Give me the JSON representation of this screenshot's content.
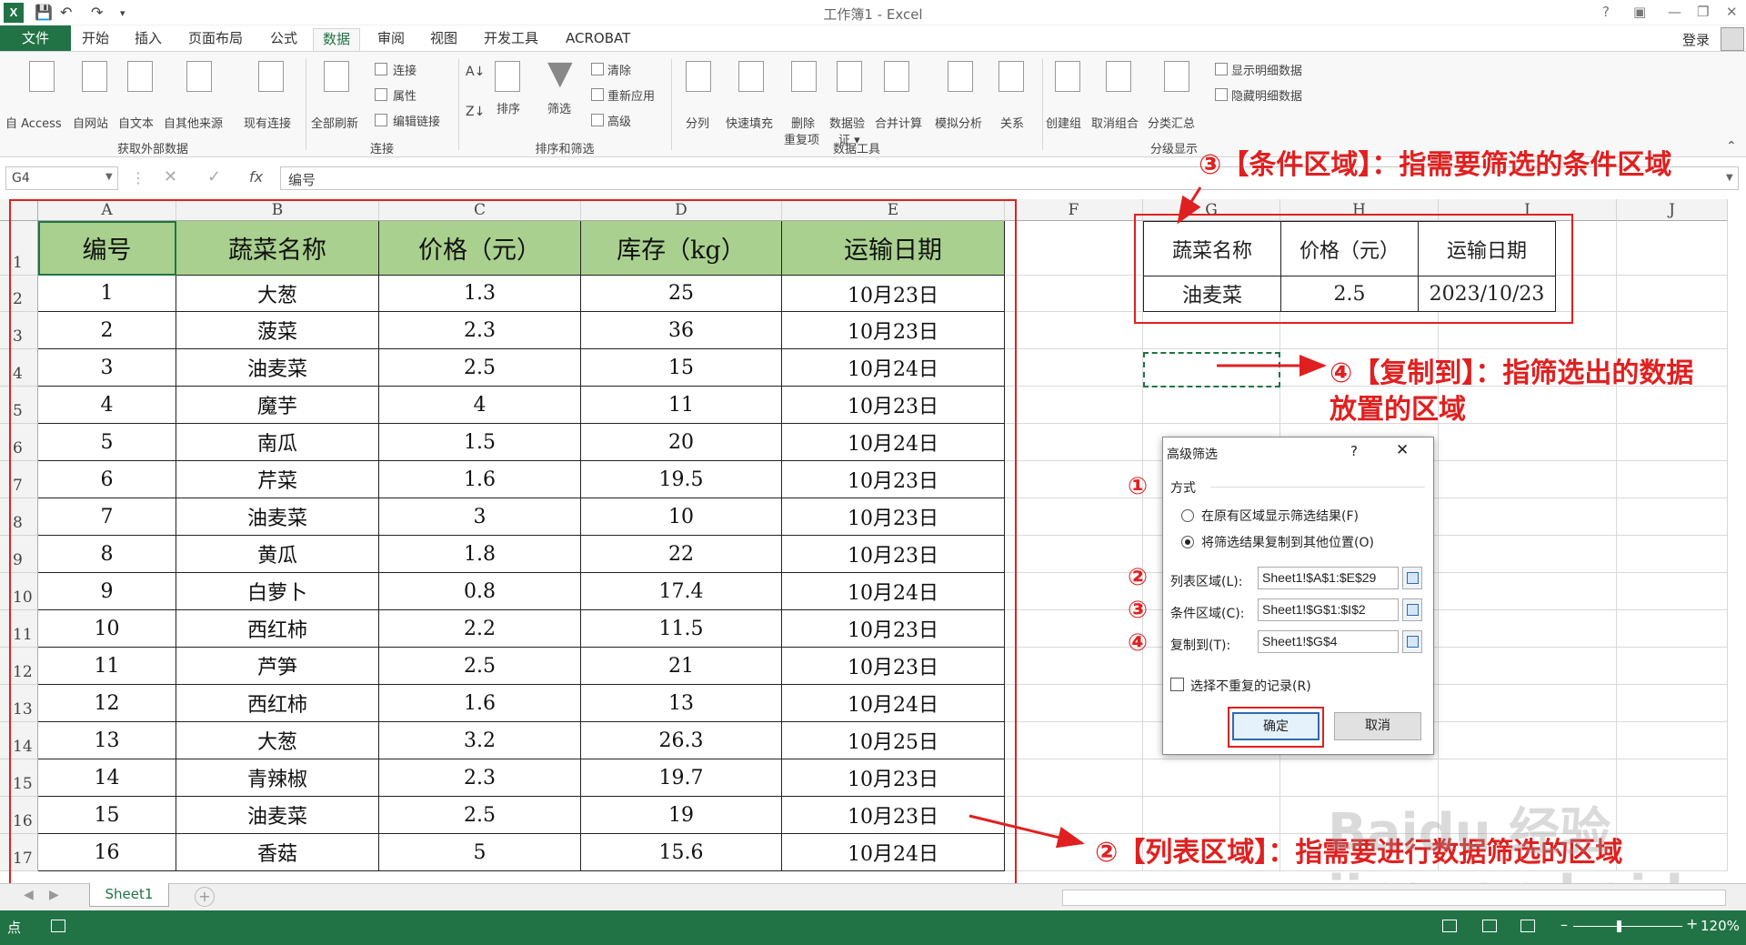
{
  "window": {
    "title": "工作簿1 - Excel",
    "help": "?",
    "user": "登录"
  },
  "tabs": [
    "文件",
    "开始",
    "插入",
    "页面布局",
    "公式",
    "数据",
    "审阅",
    "视图",
    "开发工具",
    "ACROBAT"
  ],
  "ribbon": {
    "external": {
      "access": "自 Access",
      "web": "自网站",
      "text": "自文本",
      "other": "自其他来源",
      "existing": "现有连接",
      "group": "获取外部数据"
    },
    "connections": {
      "refresh": "全部刷新",
      "connect": "连接",
      "props": "属性",
      "edit": "编辑链接",
      "group": "连接"
    },
    "sortfilter": {
      "sort": "排序",
      "filter": "筛选",
      "clear": "清除",
      "reapply": "重新应用",
      "advanced": "高级",
      "group": "排序和筛选"
    },
    "tools": {
      "split": "分列",
      "flash": "快速填充",
      "remove": "删除",
      "remove2": "重复项",
      "validate": "数据验",
      "validate2": "证 ▾",
      "consolidate": "合并计算",
      "whatif": "模拟分析",
      "relations": "关系",
      "group": "数据工具"
    },
    "outline": {
      "group_btn": "创建组",
      "ungroup": "取消组合",
      "subtotal": "分类汇总",
      "show": "显示明细数据",
      "hide": "隐藏明细数据",
      "group": "分级显示"
    }
  },
  "formula": {
    "namebox": "G4",
    "fx": "fx",
    "content": "编号"
  },
  "columns": [
    "A",
    "B",
    "C",
    "D",
    "E",
    "F",
    "G",
    "H",
    "I",
    "J"
  ],
  "rows": [
    "1",
    "2",
    "3",
    "4",
    "5",
    "6",
    "7",
    "8",
    "9",
    "10",
    "11",
    "12",
    "13",
    "14",
    "15",
    "16",
    "17"
  ],
  "table": {
    "headers": [
      "编号",
      "蔬菜名称",
      "价格（元）",
      "库存（kg）",
      "运输日期"
    ],
    "data": [
      [
        "1",
        "大葱",
        "1.3",
        "25",
        "10月23日"
      ],
      [
        "2",
        "菠菜",
        "2.3",
        "36",
        "10月23日"
      ],
      [
        "3",
        "油麦菜",
        "2.5",
        "15",
        "10月24日"
      ],
      [
        "4",
        "魔芋",
        "4",
        "11",
        "10月23日"
      ],
      [
        "5",
        "南瓜",
        "1.5",
        "20",
        "10月24日"
      ],
      [
        "6",
        "芹菜",
        "1.6",
        "19.5",
        "10月23日"
      ],
      [
        "7",
        "油麦菜",
        "3",
        "10",
        "10月23日"
      ],
      [
        "8",
        "黄瓜",
        "1.8",
        "22",
        "10月23日"
      ],
      [
        "9",
        "白萝卜",
        "0.8",
        "17.4",
        "10月24日"
      ],
      [
        "10",
        "西红柿",
        "2.2",
        "11.5",
        "10月23日"
      ],
      [
        "11",
        "芦笋",
        "2.5",
        "21",
        "10月23日"
      ],
      [
        "12",
        "西红柿",
        "1.6",
        "13",
        "10月24日"
      ],
      [
        "13",
        "大葱",
        "3.2",
        "26.3",
        "10月25日"
      ],
      [
        "14",
        "青辣椒",
        "2.3",
        "19.7",
        "10月23日"
      ],
      [
        "15",
        "油麦菜",
        "2.5",
        "19",
        "10月23日"
      ],
      [
        "16",
        "香菇",
        "5",
        "15.6",
        "10月24日"
      ]
    ]
  },
  "criteria": {
    "headers": [
      "蔬菜名称",
      "价格（元）",
      "运输日期"
    ],
    "values": [
      "油麦菜",
      "2.5",
      "2023/10/23"
    ]
  },
  "annotations": {
    "condition": "③【条件区域】：指需要筛选的条件区域",
    "copyto_1": "④【复制到】：指筛选出的数据",
    "copyto_2": "放置的区域",
    "list": "②【列表区域】：指需要进行数据筛选的区域"
  },
  "dialog": {
    "title": "高级筛选",
    "help": "?",
    "close": "✕",
    "mode_label": "方式",
    "opt1": "在原有区域显示筛选结果(F)",
    "opt2": "将筛选结果复制到其他位置(O)",
    "list_label": "列表区域(L):",
    "list_value": "Sheet1!$A$1:$E$29",
    "crit_label": "条件区域(C):",
    "crit_value": "Sheet1!$G$1:$I$2",
    "copy_label": "复制到(T):",
    "copy_value": "Sheet1!$G$4",
    "unique": "选择不重复的记录(R)",
    "ok": "确定",
    "cancel": "取消",
    "marks": [
      "①",
      "②",
      "③",
      "④"
    ]
  },
  "sheet": {
    "tab": "Sheet1",
    "add": "+"
  },
  "status": {
    "left": "点",
    "zoom": "120%"
  },
  "watermark": "Baidu 经验 jingyan.baidu.com"
}
